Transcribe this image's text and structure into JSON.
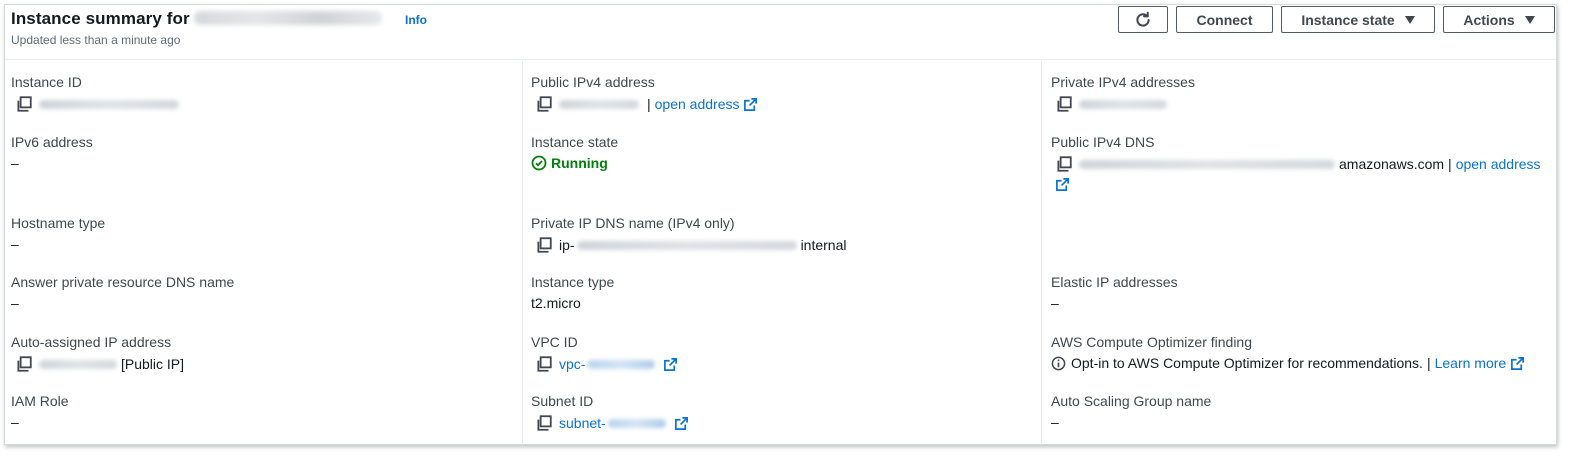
{
  "header": {
    "title": "Instance summary for",
    "info": "Info",
    "subtitle": "Updated less than a minute ago",
    "buttons": {
      "connect": "Connect",
      "instance_state": "Instance state",
      "actions": "Actions"
    }
  },
  "colors": {
    "link": "#0972d3",
    "running": "#037f0c",
    "text": "#16191f",
    "label": "#414750"
  },
  "fields": {
    "instance_id": {
      "label": "Instance ID"
    },
    "ipv6": {
      "label": "IPv6 address",
      "value": "–"
    },
    "hostname_type": {
      "label": "Hostname type",
      "value": "–"
    },
    "answer_dns": {
      "label": "Answer private resource DNS name",
      "value": "–"
    },
    "auto_ip": {
      "label": "Auto-assigned IP address",
      "suffix": "[Public IP]"
    },
    "iam_role": {
      "label": "IAM Role",
      "value": "–"
    },
    "public_ipv4": {
      "label": "Public IPv4 address",
      "sep": "|",
      "link": "open address"
    },
    "instance_state": {
      "label": "Instance state",
      "value": "Running"
    },
    "private_dns": {
      "label": "Private IP DNS name (IPv4 only)",
      "prefix": "ip-",
      "suffix": "internal"
    },
    "instance_type": {
      "label": "Instance type",
      "value": "t2.micro"
    },
    "vpc_id": {
      "label": "VPC ID",
      "prefix": "vpc-"
    },
    "subnet_id": {
      "label": "Subnet ID",
      "prefix": "subnet-"
    },
    "private_ipv4": {
      "label": "Private IPv4 addresses"
    },
    "public_dns": {
      "label": "Public IPv4 DNS",
      "suffix": "amazonaws.com",
      "sep": "|",
      "link": "open address"
    },
    "elastic_ip": {
      "label": "Elastic IP addresses",
      "value": "–"
    },
    "optimizer": {
      "label": "AWS Compute Optimizer finding",
      "text": "Opt-in to AWS Compute Optimizer for recommendations.",
      "sep": "|",
      "link": "Learn more"
    },
    "asg": {
      "label": "Auto Scaling Group name",
      "value": "–"
    }
  }
}
